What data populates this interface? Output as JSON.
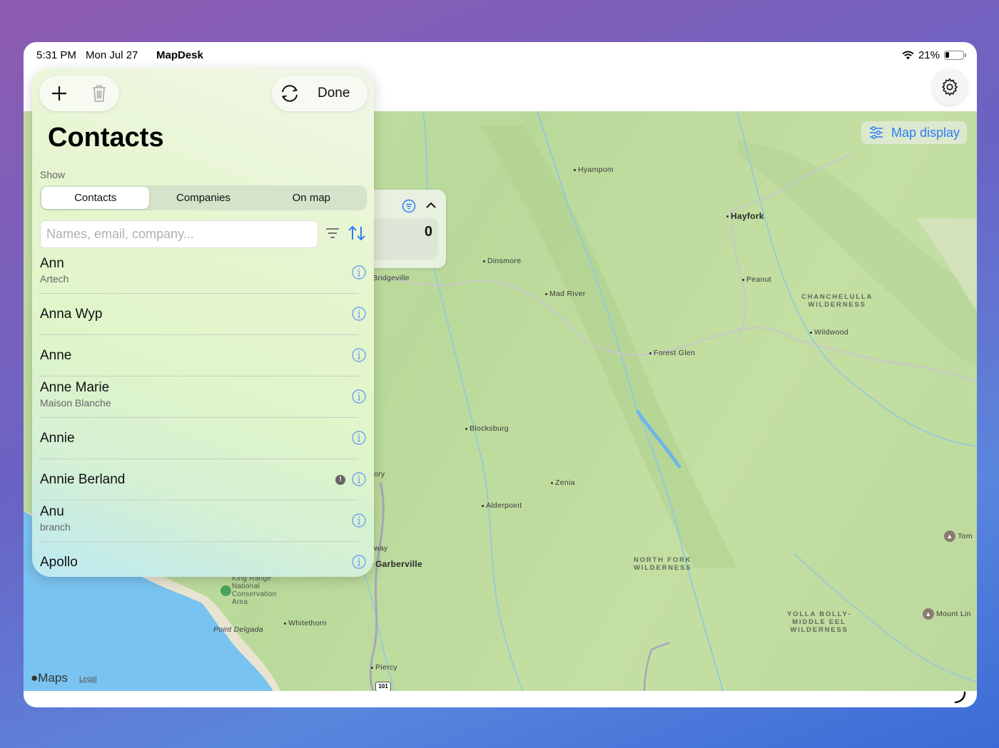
{
  "status_bar": {
    "time": "5:31 PM",
    "date": "Mon Jul 27",
    "app": "MapDesk",
    "battery": "21%",
    "battery_level": 0.21
  },
  "map": {
    "map_display_label": "Map display",
    "stats_value": "0",
    "attribution": "Maps",
    "legal": "Legal",
    "places": [
      {
        "name": "Hyampom"
      },
      {
        "name": "Hayfork"
      },
      {
        "name": "Dinsmore"
      },
      {
        "name": "Bridgeville"
      },
      {
        "name": "Mad River"
      },
      {
        "name": "Peanut"
      },
      {
        "name": "Wildwood"
      },
      {
        "name": "Forest Glen"
      },
      {
        "name": "Blocksburg"
      },
      {
        "name": "Zenia"
      },
      {
        "name": "Alderpoint"
      },
      {
        "name": "Garberville"
      },
      {
        "name": "Whitethorn"
      },
      {
        "name": "Piercy"
      },
      {
        "name": "Point Delgada"
      },
      {
        "name": "Tom"
      },
      {
        "name": "Mount Lin"
      },
      {
        "name": "ory"
      },
      {
        "name": "way"
      }
    ],
    "regions": [
      {
        "name": "CHANCHELULLA\nWILDERNESS"
      },
      {
        "name": "NORTH FORK\nWILDERNESS"
      },
      {
        "name": "YOLLA BOLLY-\nMIDDLE EEL\nWILDERNESS"
      },
      {
        "name": "King Range\nNational\nConservation\nArea"
      }
    ],
    "route": "101"
  },
  "contacts": {
    "done_label": "Done",
    "title": "Contacts",
    "show_label": "Show",
    "segments": [
      "Contacts",
      "Companies",
      "On map"
    ],
    "search_placeholder": "Names, email, company...",
    "items": [
      {
        "name": "Ann",
        "sub": "Artech"
      },
      {
        "name": "Anna Wyp",
        "sub": ""
      },
      {
        "name": "Anne",
        "sub": ""
      },
      {
        "name": "Anne Marie",
        "sub": "Maison Blanche"
      },
      {
        "name": "Annie",
        "sub": ""
      },
      {
        "name": "Annie Berland",
        "sub": "",
        "badge": "!"
      },
      {
        "name": "Anu",
        "sub": "branch"
      },
      {
        "name": "Apollo",
        "sub": ""
      }
    ]
  },
  "colors": {
    "accent": "#2f7bf5",
    "map_green": "#c2dea0",
    "water": "#7fc4ef"
  }
}
